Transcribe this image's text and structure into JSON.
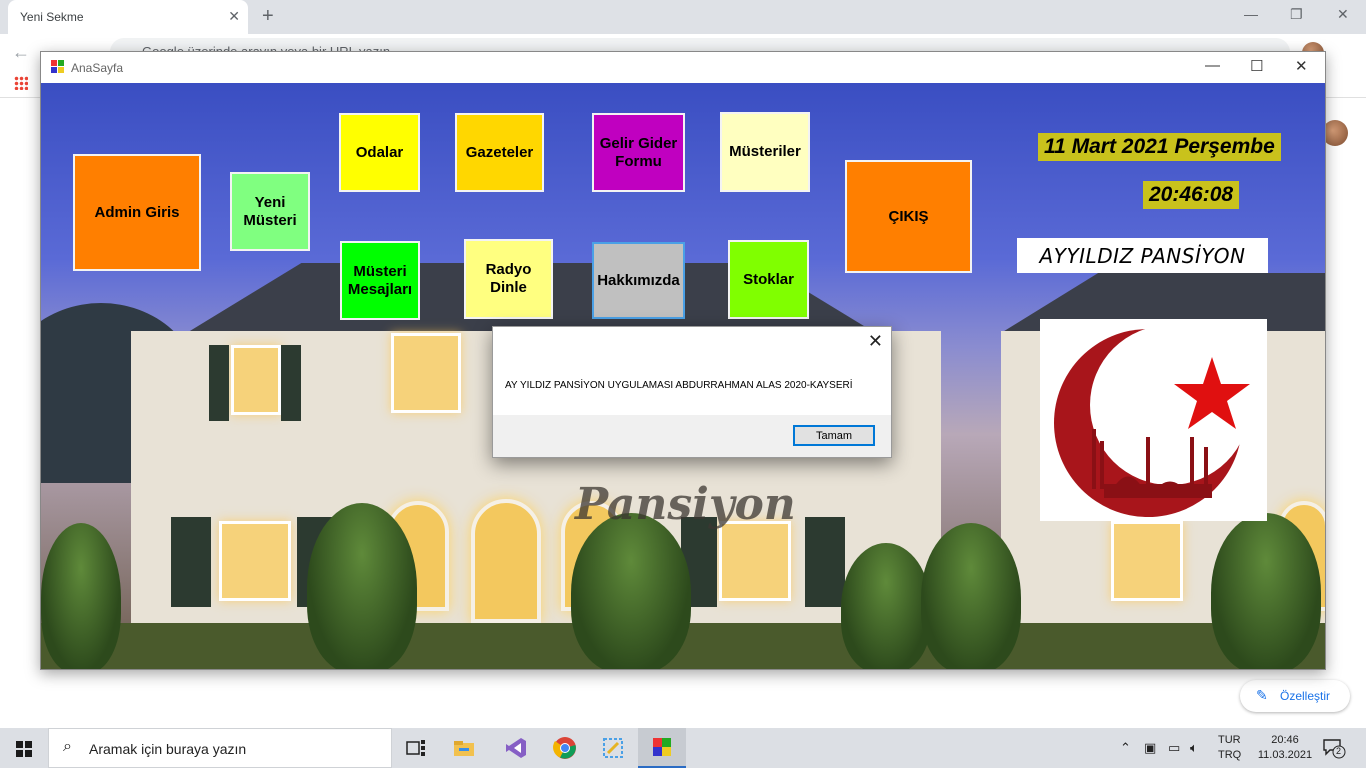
{
  "browser": {
    "tab_title": "Yeni Sekme",
    "tab_close": "✕",
    "new_tab": "+",
    "omnibox_placeholder": "Google üzerinde arayın veya bir URL yazın",
    "customize_label": "Özelleştir"
  },
  "form": {
    "title": "AnaSayfa",
    "minimize": "—",
    "maximize": "☐",
    "close": "✕",
    "background_text": "Pansiyon",
    "tiles": {
      "admin": "Admin   Giris",
      "yeni_musteri": "Yeni Müsteri",
      "odalar": "Odalar",
      "gazeteler": "Gazeteler",
      "gelir_gider": "Gelir Gider Formu",
      "musteriler": "Müsteriler",
      "cikis": "ÇIKIŞ",
      "musteri_mesajlari": "Müsteri Mesajları",
      "radyo": "Radyo Dinle",
      "hakkimizda": "Hakkımızda",
      "stoklar": "Stoklar"
    },
    "date": "11 Mart 2021 Perşembe",
    "time": "20:46:08",
    "brand": "AYYILDIZ PANSİYON"
  },
  "colors": {
    "admin": "#ff7f00",
    "yeni_musteri": "#80ff80",
    "odalar": "#ffff00",
    "gazeteler": "#ffd700",
    "gelir_gider": "#c000c0",
    "musteriler": "#ffffc0",
    "cikis": "#ff7f00",
    "musteri_mesajlari": "#00ff00",
    "radyo": "#ffff80",
    "hakkimizda": "#c0c0c0",
    "stoklar": "#80ff00",
    "label_bg": "#c9c21c",
    "crescent": "#b01418",
    "star": "#e01010"
  },
  "messagebox": {
    "close": "✕",
    "text": "AY YILDIZ PANSİYON UYGULAMASI  ABDURRAHMAN ALAS 2020-KAYSERİ",
    "ok_label": "Tamam"
  },
  "taskbar": {
    "search_placeholder": "Aramak için buraya yazın",
    "lang_top": "TUR",
    "lang_bottom": "TRQ",
    "time": "20:46",
    "date": "11.03.2021",
    "notification_count": "2"
  }
}
